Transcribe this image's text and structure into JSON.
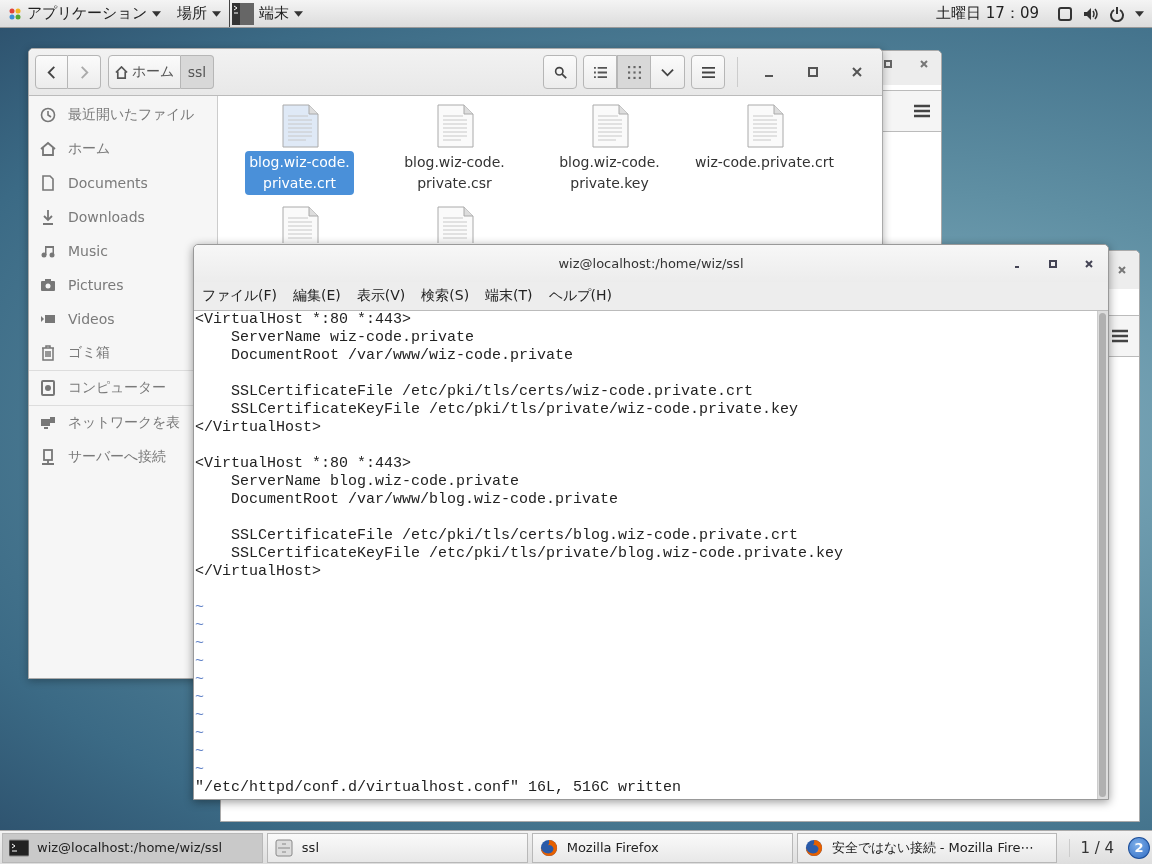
{
  "top_bar": {
    "applications_menu": "アプリケーション",
    "places_menu": "場所",
    "app_menu": "端末",
    "clock": "土曜日 17：09"
  },
  "file_manager": {
    "path": [
      {
        "label": "ホーム",
        "selected": false
      },
      {
        "label": "ssl",
        "selected": true
      }
    ],
    "view_modes": [
      {
        "kind": "list",
        "selected": false
      },
      {
        "kind": "grid",
        "selected": true
      }
    ],
    "sidebar": [
      {
        "items": [
          {
            "label": "最近開いたファイル"
          },
          {
            "label": "ホーム"
          },
          {
            "label": "Documents"
          },
          {
            "label": "Downloads"
          },
          {
            "label": "Music"
          },
          {
            "label": "Pictures"
          },
          {
            "label": "Videos"
          },
          {
            "label": "ゴミ箱"
          }
        ]
      },
      {
        "items": [
          {
            "label": "コンピューター"
          }
        ]
      },
      {
        "items": [
          {
            "label": "ネットワークを表"
          },
          {
            "label": "サーバーへ接続"
          }
        ]
      }
    ],
    "files": [
      {
        "name": "blog.wiz-code.\nprivate.crt",
        "selected": true
      },
      {
        "name": "blog.wiz-code.\nprivate.csr",
        "selected": false
      },
      {
        "name": "blog.wiz-code.\nprivate.key",
        "selected": false
      },
      {
        "name": "wiz-code.private.crt",
        "selected": false
      },
      {
        "kind": "partial"
      },
      {
        "kind": "partial"
      }
    ]
  },
  "terminal": {
    "title": "wiz@localhost:/home/wiz/ssl",
    "menu": [
      "ファイル(F)",
      "編集(E)",
      "表示(V)",
      "検索(S)",
      "端末(T)",
      "ヘルプ(H)"
    ],
    "lines": [
      {
        "kind": "text",
        "text": "<VirtualHost *:80 *:443>"
      },
      {
        "kind": "text",
        "text": "    ServerName wiz-code.private"
      },
      {
        "kind": "text",
        "text": "    DocumentRoot /var/www/wiz-code.private"
      },
      {
        "kind": "blank"
      },
      {
        "kind": "text",
        "text": "    SSLCertificateFile /etc/pki/tls/certs/wiz-code.private.crt"
      },
      {
        "kind": "text",
        "text": "    SSLCertificateKeyFile /etc/pki/tls/private/wiz-code.private.key"
      },
      {
        "kind": "text",
        "text": "</VirtualHost>"
      },
      {
        "kind": "blank"
      },
      {
        "kind": "text",
        "text": "<VirtualHost *:80 *:443>"
      },
      {
        "kind": "text",
        "text": "    ServerName blog.wiz-code.private"
      },
      {
        "kind": "text",
        "text": "    DocumentRoot /var/www/blog.wiz-code.private"
      },
      {
        "kind": "blank"
      },
      {
        "kind": "text",
        "text": "    SSLCertificateFile /etc/pki/tls/certs/blog.wiz-code.private.crt"
      },
      {
        "kind": "text",
        "text": "    SSLCertificateKeyFile /etc/pki/tls/private/blog.wiz-code.private.key"
      },
      {
        "kind": "text",
        "text": "</VirtualHost>"
      },
      {
        "kind": "blank"
      },
      {
        "kind": "tilde",
        "text": "~"
      },
      {
        "kind": "tilde",
        "text": "~"
      },
      {
        "kind": "tilde",
        "text": "~"
      },
      {
        "kind": "tilde",
        "text": "~"
      },
      {
        "kind": "tilde",
        "text": "~"
      },
      {
        "kind": "tilde",
        "text": "~"
      },
      {
        "kind": "tilde",
        "text": "~"
      },
      {
        "kind": "tilde",
        "text": "~"
      },
      {
        "kind": "tilde",
        "text": "~"
      },
      {
        "kind": "tilde",
        "text": "~"
      },
      {
        "kind": "text",
        "text": "\"/etc/httpd/conf.d/virtualhost.conf\" 16L, 516C written"
      }
    ]
  },
  "taskbar": {
    "tasks": [
      {
        "label": "wiz@localhost:/home/wiz/ssl",
        "kind": "terminal",
        "selected": true
      },
      {
        "label": "ssl",
        "kind": "files",
        "selected": false
      },
      {
        "label": "Mozilla Firefox",
        "kind": "browser",
        "selected": false
      },
      {
        "label": "安全ではない接続  -  Mozilla Fire⋯",
        "kind": "browser",
        "selected": false
      }
    ],
    "workspace": "1 / 4",
    "notifications": "2"
  }
}
